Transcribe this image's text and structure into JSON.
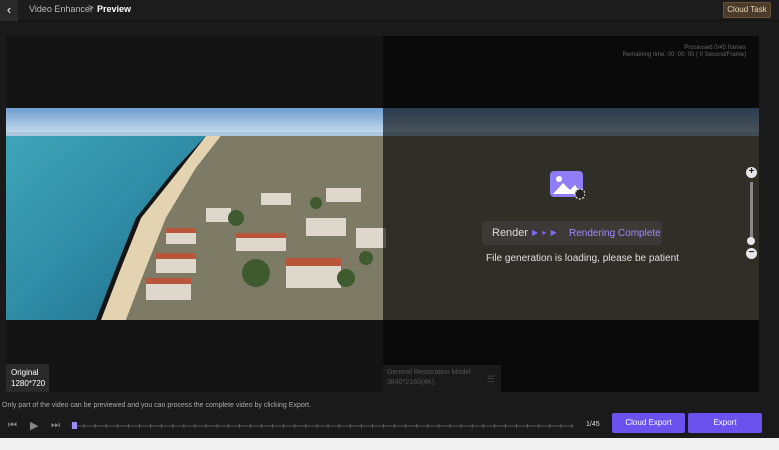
{
  "header": {
    "back_icon": "chevron-left-icon",
    "breadcrumb": "Video Enhancer",
    "separator": ">",
    "current": "Preview",
    "cloud_task": "Cloud Task"
  },
  "preview": {
    "processed": "Processed 0/45 frames",
    "remaining": "Remaining time: 00: 00: 00 ( 0 Second/Frame)",
    "render_label": "Render",
    "render_status": "Rendering Complete",
    "render_message": "File generation is loading, please be patient",
    "left_tag": {
      "title": "Original",
      "resolution": "1280*720"
    },
    "right_tag": {
      "title": "General Restoration Model",
      "resolution": "3840*2160(4K)"
    }
  },
  "zoom": {
    "plus": "+",
    "minus": "−",
    "level": 0.92
  },
  "hint": "Only part of the video can be previewed and you can process the complete video by clicking Export.",
  "player": {
    "prev": "⏮",
    "play": "▶",
    "next": "⏭",
    "frame": "1/45",
    "position": 0.0
  },
  "buttons": {
    "cloud_export": "Cloud Export",
    "export": "Export"
  },
  "colors": {
    "accent": "#6b52ee",
    "status": "#9d8bff",
    "cloud_task_bg": "#4a3b2a"
  }
}
